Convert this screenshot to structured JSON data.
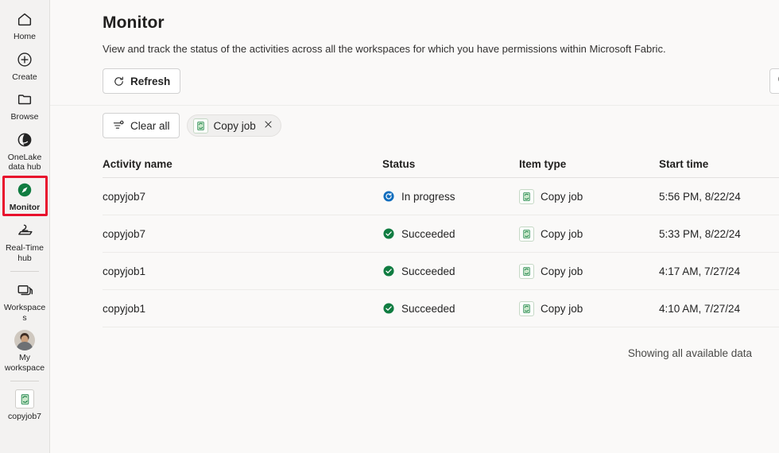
{
  "sidebar": {
    "items": [
      {
        "label": "Home",
        "icon": "home-icon",
        "selected": false,
        "divider_after": false
      },
      {
        "label": "Create",
        "icon": "plus-circle-icon",
        "selected": false,
        "divider_after": false
      },
      {
        "label": "Browse",
        "icon": "folder-icon",
        "selected": false,
        "divider_after": false
      },
      {
        "label": "OneLake data hub",
        "icon": "onelake-icon",
        "selected": false,
        "divider_after": false
      },
      {
        "label": "Monitor",
        "icon": "monitor-compass-icon",
        "selected": true,
        "divider_after": false
      },
      {
        "label": "Real-Time hub",
        "icon": "real-time-hub-icon",
        "selected": false,
        "divider_after": true
      },
      {
        "label": "Workspaces",
        "icon": "workspaces-icon",
        "selected": false,
        "divider_after": false
      },
      {
        "label": "My workspace",
        "icon": "user-avatar",
        "selected": false,
        "divider_after": true
      },
      {
        "label": "copyjob7",
        "icon": "copy-job-icon",
        "selected": false,
        "divider_after": false
      }
    ],
    "selection_highlight_color": "#e8112d"
  },
  "header": {
    "title": "Monitor",
    "subtitle": "View and track the status of the activities across all the workspaces for which you have permissions within Microsoft Fabric."
  },
  "toolbar": {
    "refresh_label": "Refresh",
    "refresh_icon": "refresh-icon",
    "search_icon": "search-icon"
  },
  "filters": {
    "clear_all_label": "Clear all",
    "clear_all_icon": "clear-filter-icon",
    "active_filter": {
      "label": "Copy job",
      "icon": "copy-job-icon",
      "remove_icon": "close-icon"
    }
  },
  "table": {
    "columns": [
      "Activity name",
      "Status",
      "Item type",
      "Start time"
    ],
    "rows": [
      {
        "activity_name": "copyjob7",
        "status": "In progress",
        "status_kind": "in-progress",
        "item_type": "Copy job",
        "start_time": "5:56 PM, 8/22/24"
      },
      {
        "activity_name": "copyjob7",
        "status": "Succeeded",
        "status_kind": "succeeded",
        "item_type": "Copy job",
        "start_time": "5:33 PM, 8/22/24"
      },
      {
        "activity_name": "copyjob1",
        "status": "Succeeded",
        "status_kind": "succeeded",
        "item_type": "Copy job",
        "start_time": "4:17 AM, 7/27/24"
      },
      {
        "activity_name": "copyjob1",
        "status": "Succeeded",
        "status_kind": "succeeded",
        "item_type": "Copy job",
        "start_time": "4:10 AM, 7/27/24"
      }
    ]
  },
  "footer": {
    "note": "Showing all available data"
  },
  "colors": {
    "accent_green": "#107c41",
    "status_in_progress": "#0f6cbd",
    "status_succeeded": "#107c41",
    "highlight_red": "#e8112d",
    "page_background": "#faf9f8",
    "sidebar_background": "#f3f2f1"
  }
}
